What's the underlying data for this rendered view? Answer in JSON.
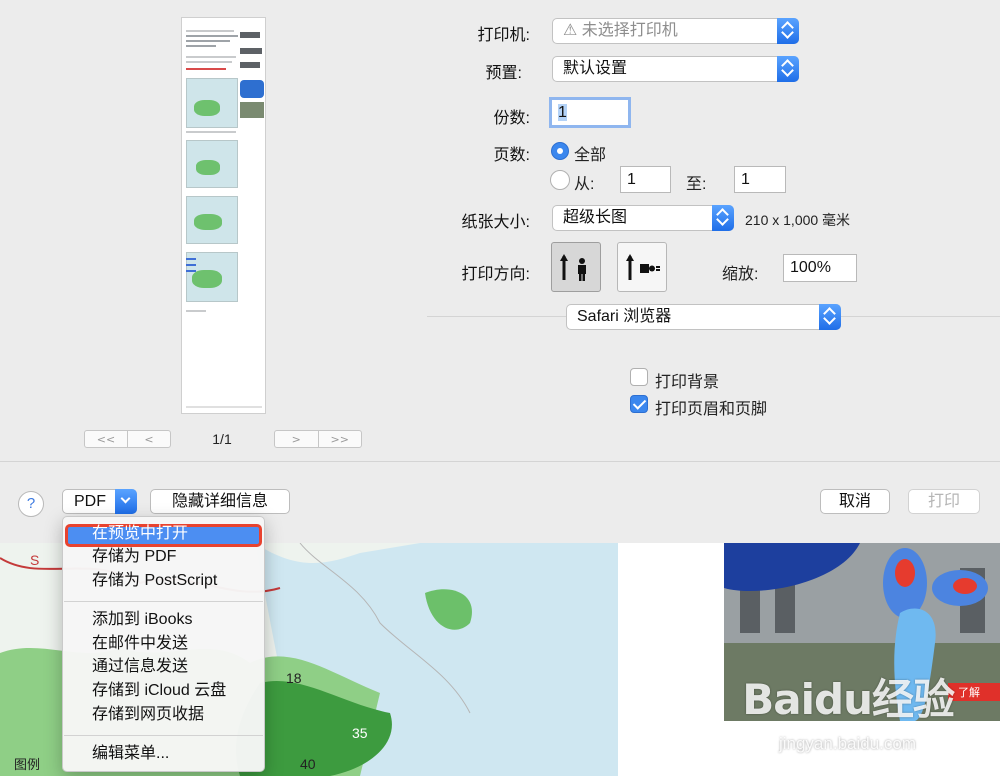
{
  "preview": {
    "page_indicator": "1/1",
    "first": "<<",
    "prev": "<",
    "next": ">",
    "last": ">>"
  },
  "printer": {
    "label": "打印机:",
    "value": "⚠ 未选择打印机"
  },
  "preset": {
    "label": "预置:",
    "value": "默认设置"
  },
  "copies": {
    "label": "份数:",
    "value": "1"
  },
  "pages": {
    "label": "页数:",
    "all_label": "全部",
    "from_label": "从:",
    "from_value": "1",
    "to_label": "至:",
    "to_value": "1"
  },
  "paper": {
    "label": "纸张大小:",
    "value": "超级长图",
    "dims": "210 x 1,000 毫米"
  },
  "orientation": {
    "label": "打印方向:",
    "scale_label": "缩放:",
    "scale_value": "100%"
  },
  "app_section": {
    "value": "Safari 浏览器"
  },
  "options": {
    "print_bg": "打印背景",
    "print_headers": "打印页眉和页脚"
  },
  "footer": {
    "help": "?",
    "pdf": "PDF",
    "hide_details": "隐藏详细信息",
    "cancel": "取消",
    "print": "打印"
  },
  "pdf_menu": {
    "group1": [
      "在预览中打开",
      "存储为 PDF",
      "存储为 PostScript"
    ],
    "group2": [
      "添加到 iBooks",
      "在邮件中发送",
      "通过信息发送",
      "存储到 iCloud 云盘",
      "存储到网页收据"
    ],
    "group3": [
      "编辑菜单..."
    ]
  },
  "watermark": {
    "brand": "Baidu经验",
    "url": "jingyan.baidu.com"
  },
  "map": {
    "numbers": [
      "18",
      "35",
      "40"
    ],
    "legend": "图例"
  }
}
